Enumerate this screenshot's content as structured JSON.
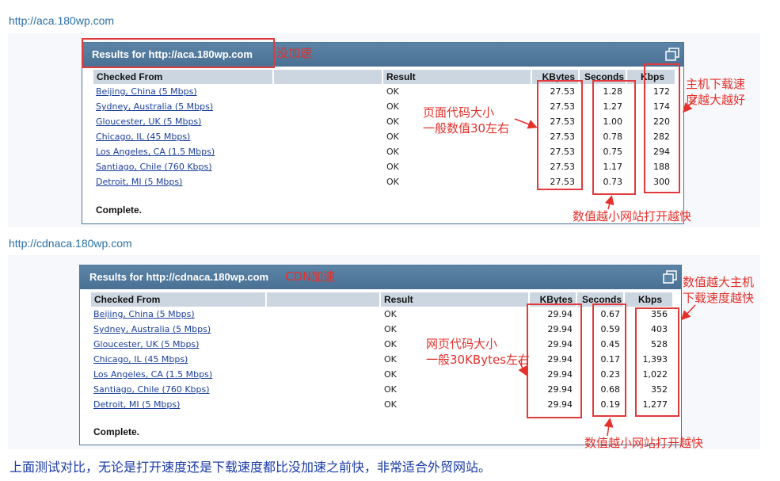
{
  "sections": [
    {
      "url": "http://aca.180wp.com",
      "panel_title": "Results for http://aca.180wp.com",
      "label": "没加速",
      "columns": [
        "Checked From",
        "Result",
        "KBytes",
        "Seconds",
        "Kbps"
      ],
      "rows": [
        {
          "from": "Beijing, China (5 Mbps)",
          "result": "OK",
          "kbytes": "27.53",
          "seconds": "1.28",
          "kbps": "172"
        },
        {
          "from": "Sydney, Australia (5 Mbps)",
          "result": "OK",
          "kbytes": "27.53",
          "seconds": "1.27",
          "kbps": "174"
        },
        {
          "from": "Gloucester, UK (5 Mbps)",
          "result": "OK",
          "kbytes": "27.53",
          "seconds": "1.00",
          "kbps": "220"
        },
        {
          "from": "Chicago, IL (45 Mbps)",
          "result": "OK",
          "kbytes": "27.53",
          "seconds": "0.78",
          "kbps": "282"
        },
        {
          "from": "Los Angeles, CA (1.5 Mbps)",
          "result": "OK",
          "kbytes": "27.53",
          "seconds": "0.75",
          "kbps": "294"
        },
        {
          "from": "Santiago, Chile (760 Kbps)",
          "result": "OK",
          "kbytes": "27.53",
          "seconds": "1.17",
          "kbps": "188"
        },
        {
          "from": "Detroit, MI (5 Mbps)",
          "result": "OK",
          "kbytes": "27.53",
          "seconds": "0.73",
          "kbps": "300"
        }
      ],
      "complete": "Complete.",
      "notes": {
        "size": [
          "页面代码大小",
          "一般数值30左右"
        ],
        "seconds": "数值越小网站打开越快",
        "kbps": [
          "主机下载速",
          "度越大越好"
        ]
      }
    },
    {
      "url": "http://cdnaca.180wp.com",
      "panel_title": "Results for http://cdnaca.180wp.com",
      "label": "CDN加速",
      "columns": [
        "Checked From",
        "Result",
        "KBytes",
        "Seconds",
        "Kbps"
      ],
      "rows": [
        {
          "from": "Beijing, China (5 Mbps)",
          "result": "OK",
          "kbytes": "29.94",
          "seconds": "0.67",
          "kbps": "356"
        },
        {
          "from": "Sydney, Australia (5 Mbps)",
          "result": "OK",
          "kbytes": "29.94",
          "seconds": "0.59",
          "kbps": "403"
        },
        {
          "from": "Gloucester, UK (5 Mbps)",
          "result": "OK",
          "kbytes": "29.94",
          "seconds": "0.45",
          "kbps": "528"
        },
        {
          "from": "Chicago, IL (45 Mbps)",
          "result": "OK",
          "kbytes": "29.94",
          "seconds": "0.17",
          "kbps": "1,393"
        },
        {
          "from": "Los Angeles, CA (1.5 Mbps)",
          "result": "OK",
          "kbytes": "29.94",
          "seconds": "0.23",
          "kbps": "1,022"
        },
        {
          "from": "Santiago, Chile (760 Kbps)",
          "result": "OK",
          "kbytes": "29.94",
          "seconds": "0.68",
          "kbps": "352"
        },
        {
          "from": "Detroit, MI (5 Mbps)",
          "result": "OK",
          "kbytes": "29.94",
          "seconds": "0.19",
          "kbps": "1,277"
        }
      ],
      "complete": "Complete.",
      "notes": {
        "size": [
          "网页代码大小",
          "一般30KBytes左右"
        ],
        "seconds": "数值越小网站打开越快",
        "kbps": [
          "数值越大主机",
          "下载速度越快"
        ]
      }
    }
  ],
  "summary": "上面测试对比，无论是打开速度还是下载速度都比没加速之前快，非常适合外贸网站。",
  "colors": {
    "annotation": "#e5302b",
    "header": "#4d7698",
    "link": "#1b3f9c"
  }
}
